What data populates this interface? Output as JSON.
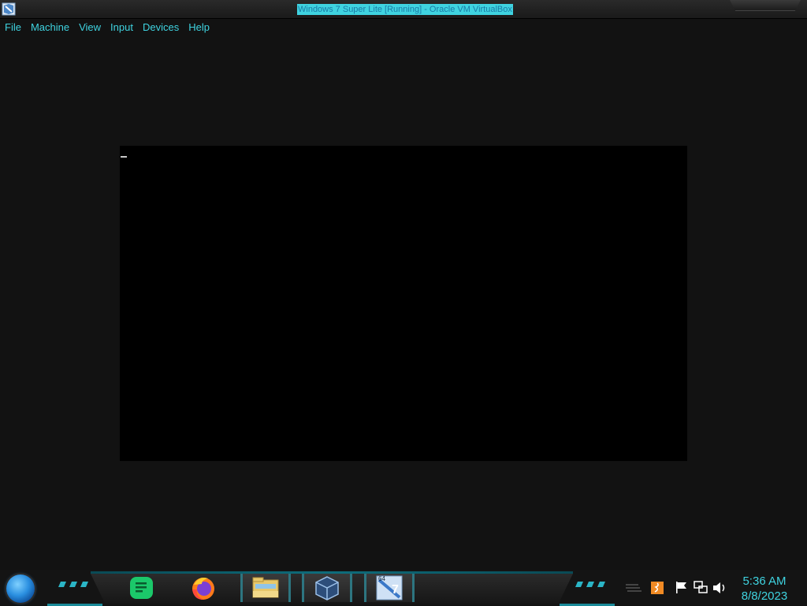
{
  "window": {
    "title": "Windows 7 Super Lite [Running] - Oracle VM VirtualBox"
  },
  "menu": [
    "File",
    "Machine",
    "View",
    "Input",
    "Devices",
    "Help"
  ],
  "taskbar": {
    "apps": [
      {
        "name": "Notes",
        "icon": "notes-icon"
      },
      {
        "name": "Firefox",
        "icon": "firefox-icon"
      },
      {
        "name": "File Explorer",
        "icon": "folder-icon"
      },
      {
        "name": "VirtualBox",
        "icon": "virtualbox-icon"
      },
      {
        "name": "Windows 7 VM",
        "icon": "windows7-vm-icon",
        "badge": "64",
        "label": "7"
      }
    ],
    "tray": [
      "show-hidden-icon",
      "java-update-icon",
      "action-center-flag-icon",
      "network-icon",
      "volume-icon"
    ],
    "clock": {
      "time": "5:36 AM",
      "date": "8/8/2023"
    }
  },
  "colors": {
    "accent": "#3fd3e0",
    "background": "#121212",
    "vm_screen": "#000000"
  }
}
